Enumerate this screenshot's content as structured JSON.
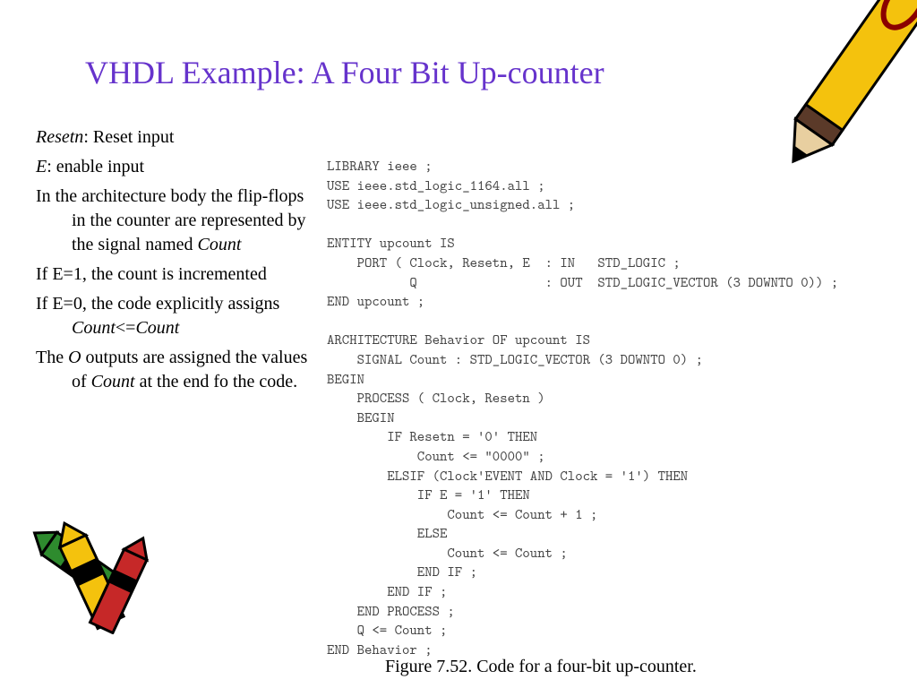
{
  "title": "VHDL Example: A Four Bit Up-counter",
  "left": {
    "l1a": "Resetn",
    "l1b": ": Reset input",
    "l2a": "E",
    "l2b": ": enable input",
    "l3a": "In the architecture body the flip-flops in the counter are represented by the signal named ",
    "l3b": "Count",
    "l4": "If E=1, the count is incremented",
    "l5a": "If E=0, the code explicitly assigns ",
    "l5b": "Count",
    "l5c": "<=",
    "l5d": "Count",
    "l6a": "The ",
    "l6b": "O",
    "l6c": " outputs are assigned the values of ",
    "l6d": "Count",
    "l6e": " at the end fo the code."
  },
  "code": {
    "c01": "LIBRARY ieee ;",
    "c02": "USE ieee.std_logic_1164.all ;",
    "c03": "USE ieee.std_logic_unsigned.all ;",
    "c04": "",
    "c05": "ENTITY upcount IS",
    "c06": "    PORT ( Clock, Resetn, E  : IN   STD_LOGIC ;",
    "c07": "           Q                 : OUT  STD_LOGIC_VECTOR (3 DOWNTO 0)) ;",
    "c08": "END upcount ;",
    "c09": "",
    "c10": "ARCHITECTURE Behavior OF upcount IS",
    "c11": "    SIGNAL Count : STD_LOGIC_VECTOR (3 DOWNTO 0) ;",
    "c12": "BEGIN",
    "c13": "    PROCESS ( Clock, Resetn )",
    "c14": "    BEGIN",
    "c15": "        IF Resetn = '0' THEN",
    "c16": "            Count <= \"0000\" ;",
    "c17": "        ELSIF (Clock'EVENT AND Clock = '1') THEN",
    "c18": "            IF E = '1' THEN",
    "c19": "                Count <= Count + 1 ;",
    "c20": "            ELSE",
    "c21": "                Count <= Count ;",
    "c22": "            END IF ;",
    "c23": "        END IF ;",
    "c24": "    END PROCESS ;",
    "c25": "    Q <= Count ;",
    "c26": "END Behavior ;"
  },
  "caption": "Figure 7.52.   Code for a four-bit up-counter."
}
